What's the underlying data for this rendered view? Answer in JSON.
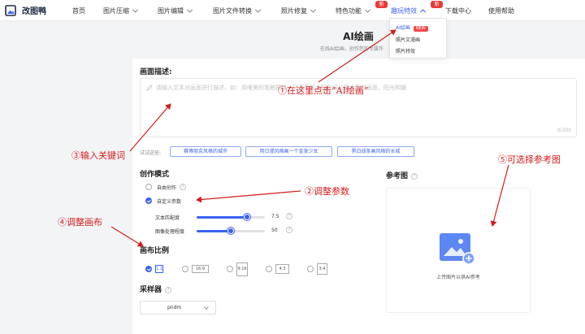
{
  "nav": {
    "logo_text": "改图鸭",
    "items": [
      {
        "label": "首页"
      },
      {
        "label": "图片压缩"
      },
      {
        "label": "图片编辑"
      },
      {
        "label": "图片文件转换"
      },
      {
        "label": "照片修复"
      },
      {
        "label": "特色功能",
        "badge": "新"
      },
      {
        "label": "趣玩特效",
        "badge": "新"
      },
      {
        "label": "下载中心"
      },
      {
        "label": "使用帮助"
      }
    ]
  },
  "dropdown": {
    "items": [
      {
        "label": "AI绘画",
        "badge": "NEW"
      },
      {
        "label": "照片文漫画"
      },
      {
        "label": "照片特效"
      }
    ]
  },
  "header": {
    "title": "AI绘画",
    "subtitle": "在线AI绘画，创作您的专属作"
  },
  "prompt": {
    "label": "画面描述:",
    "placeholder": "请输入文本对画面进行描述，如：用唯美的笔触描绘一只漂亮的小猫在窗边晒太阳的画面，阳光明媚",
    "value": "",
    "counter": "0/300",
    "try_label": "试试这些:",
    "suggestions": [
      "赛博朋克风格的城市",
      "用日漫风格画一个金发少女",
      "黑白线条画风格的长城"
    ]
  },
  "mode": {
    "title": "创作模式",
    "help": "?",
    "options": [
      {
        "label": "自由创作",
        "help": "?",
        "selected": false
      },
      {
        "label": "自定义参数",
        "selected": true
      }
    ]
  },
  "params": {
    "text_match": {
      "label": "文本匹配度",
      "value": "7.5",
      "fraction": 0.74
    },
    "image_strength": {
      "label": "图像处理程度",
      "value": "50",
      "fraction": 0.5
    }
  },
  "ratio": {
    "title": "画布比例",
    "options": [
      {
        "label": "1:1",
        "selected": true
      },
      {
        "label": "16:9",
        "selected": false
      },
      {
        "label": "9:16",
        "selected": false
      },
      {
        "label": "4:3",
        "selected": false
      },
      {
        "label": "3:4",
        "selected": false
      }
    ]
  },
  "sampler": {
    "title": "采样器",
    "help": "?",
    "value": "pndm"
  },
  "reference": {
    "title": "参考图",
    "help": "?",
    "upload_text": "上传图片以供AI参考"
  },
  "annotations": {
    "step1": "①在这里点击“AI绘画”",
    "step2": "②调整参数",
    "step3": "③输入关键词",
    "step4": "④调整画布",
    "step5": "⑤可选择参考图"
  },
  "colors": {
    "accent": "#3a63f0",
    "annotation": "#d31b1b",
    "badge": "#e83a3a"
  }
}
